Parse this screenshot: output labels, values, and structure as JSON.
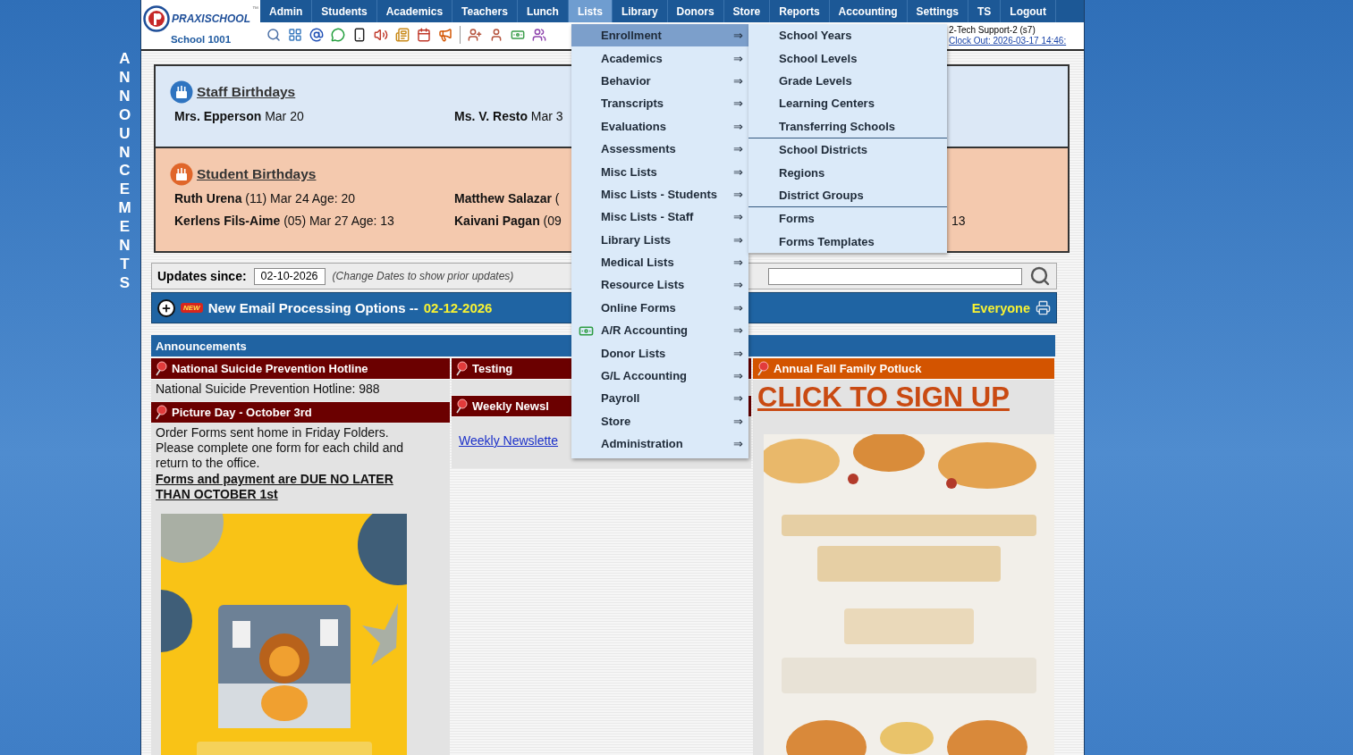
{
  "sidebar": {
    "vertical_label": "ANNOUNCEMENTS"
  },
  "header": {
    "logo": {
      "name": "PRAXISCHOOL",
      "mark": "™",
      "school": "School 1001"
    },
    "nav": [
      {
        "label": "Admin",
        "selected": false
      },
      {
        "label": "Students",
        "selected": false
      },
      {
        "label": "Academics",
        "selected": false
      },
      {
        "label": "Teachers",
        "selected": false
      },
      {
        "label": "Lunch",
        "selected": false
      },
      {
        "label": "Lists",
        "selected": true
      },
      {
        "label": "Library",
        "selected": false
      },
      {
        "label": "Donors",
        "selected": false
      },
      {
        "label": "Store",
        "selected": false
      },
      {
        "label": "Reports",
        "selected": false
      },
      {
        "label": "Accounting",
        "selected": false
      },
      {
        "label": "Settings",
        "selected": false
      },
      {
        "label": "TS",
        "selected": false
      },
      {
        "label": "Logout",
        "selected": false
      }
    ],
    "user": "2-Tech Support-2 (s7)",
    "clock_out": "Clock Out: 2026-03-17 14:46:"
  },
  "birthdays": {
    "staff": {
      "title": "Staff Birthdays",
      "rows": [
        [
          {
            "name": "Mrs. Epperson",
            "detail": "Mar 20"
          },
          {
            "name": "Ms. V. Resto",
            "detail": "Mar 3"
          }
        ]
      ]
    },
    "students": {
      "title": "Student Birthdays",
      "rows": [
        [
          {
            "name": "Ruth Urena",
            "detail": "(11) Mar 24 Age: 20"
          },
          {
            "name": "Matthew Salazar",
            "detail": "("
          }
        ],
        [
          {
            "name": "Kerlens Fils-Aime",
            "detail": "(05) Mar 27 Age: 13"
          },
          {
            "name": "Kaivani Pagan",
            "detail": "(09"
          },
          {
            "detail": "13"
          }
        ]
      ]
    }
  },
  "updates": {
    "label": "Updates since:",
    "date": "02-10-2026",
    "hint": "(Change Dates to show prior updates)"
  },
  "email_notice": {
    "badge": "NEW",
    "title": "New Email Processing Options --",
    "date": "02-12-2026",
    "audience": "Everyone"
  },
  "announcements": {
    "title": "Announcements",
    "columns": [
      [
        {
          "title": "National Suicide Prevention Hotline",
          "color": "#6b0000",
          "body": [
            {
              "kind": "text",
              "text": "National Suicide Prevention Hotline: 988"
            }
          ]
        },
        {
          "title": "Picture Day - October 3rd",
          "color": "#6b0000",
          "body": [
            {
              "kind": "text",
              "text": "Order Forms sent home in Friday Folders. Please complete one form for each child and return to the office."
            },
            {
              "kind": "notice",
              "text": "Forms and payment are DUE NO LATER THAN OCTOBER 1st"
            },
            {
              "kind": "picture"
            }
          ]
        }
      ],
      [
        {
          "title": "Testing",
          "color": "#6b0000"
        },
        {
          "title": "Weekly Newsl",
          "color": "#6b0000",
          "body": [
            {
              "kind": "link",
              "text": "Weekly Newslette"
            }
          ]
        }
      ],
      [
        {
          "title": "Annual Fall Family Potluck",
          "color": "#d35400",
          "body": [
            {
              "kind": "signup",
              "text": "CLICK TO SIGN UP"
            },
            {
              "kind": "picture"
            }
          ]
        }
      ]
    ]
  },
  "lists_menu": {
    "items": [
      {
        "label": "Enrollment",
        "arrow": "⇒",
        "selected": true,
        "kind": "plain"
      },
      {
        "label": "Academics",
        "arrow": "⇒",
        "selected": false,
        "kind": "plain"
      },
      {
        "label": "Behavior",
        "arrow": "⇒",
        "selected": false,
        "kind": "plain"
      },
      {
        "label": "Transcripts",
        "arrow": "⇒",
        "selected": false,
        "kind": "plain"
      },
      {
        "label": "Evaluations",
        "arrow": "⇒",
        "selected": false,
        "kind": "plain"
      },
      {
        "label": "Assessments",
        "arrow": "⇒",
        "selected": false,
        "kind": "plain"
      },
      {
        "label": "Misc Lists",
        "arrow": "⇒",
        "selected": false,
        "kind": "plain"
      },
      {
        "label": "Misc Lists - Students",
        "arrow": "⇒",
        "selected": false,
        "kind": "plain"
      },
      {
        "label": "Misc Lists - Staff",
        "arrow": "⇒",
        "selected": false,
        "kind": "plain"
      },
      {
        "label": "Library Lists",
        "arrow": "⇒",
        "selected": false,
        "kind": "plain"
      },
      {
        "label": "Medical Lists",
        "arrow": "⇒",
        "selected": false,
        "kind": "plain"
      },
      {
        "label": "Resource Lists",
        "arrow": "⇒",
        "selected": false,
        "kind": "plain"
      },
      {
        "label": "Online Forms",
        "arrow": "⇒",
        "selected": false,
        "kind": "plain"
      },
      {
        "label": "A/R Accounting",
        "arrow": "⇒",
        "selected": false,
        "kind": "money"
      },
      {
        "label": "Donor Lists",
        "arrow": "⇒",
        "selected": false,
        "kind": "plain"
      },
      {
        "label": "G/L Accounting",
        "arrow": "⇒",
        "selected": false,
        "kind": "plain"
      },
      {
        "label": "Payroll",
        "arrow": "⇒",
        "selected": false,
        "kind": "plain"
      },
      {
        "label": "Store",
        "arrow": "⇒",
        "selected": false,
        "kind": "plain"
      },
      {
        "label": "Administration",
        "arrow": "⇒",
        "selected": false,
        "kind": "plain"
      }
    ],
    "submenu": [
      [
        "School Years",
        "School Levels",
        "Grade Levels",
        "Learning Centers",
        "Transferring Schools"
      ],
      [
        "School Districts",
        "Regions",
        "District Groups"
      ],
      [
        "Forms",
        "Forms Templates"
      ]
    ]
  }
}
